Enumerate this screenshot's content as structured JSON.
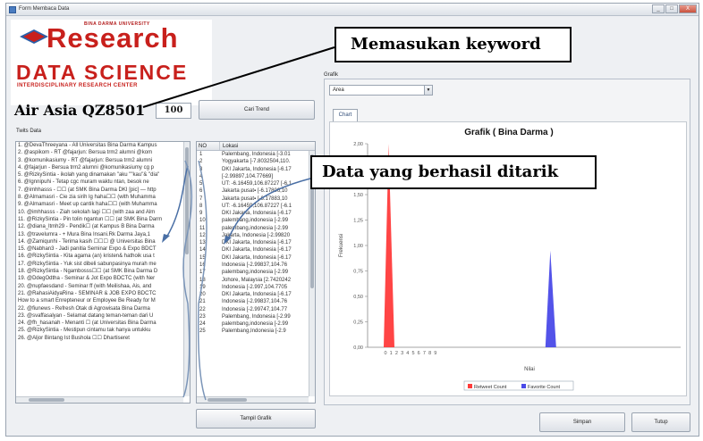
{
  "window": {
    "title": "Form Membaca Data",
    "controls": [
      "_",
      "□",
      "X"
    ]
  },
  "logo": {
    "university": "BINA DARMA UNIVERSITY",
    "research": "Research",
    "data_science": "DATA SCIENCE",
    "subtitle": "INTERDISCIPLINARY RESEARCH CENTER",
    "colors": {
      "primary": "#c8201c",
      "secondary": "#2c5fa8"
    }
  },
  "search": {
    "keyword": "Air Asia QZ8501",
    "count": "100",
    "button_label": "Cari Trend"
  },
  "twits": {
    "label": "Twits Data",
    "lines": [
      "1. @DevaThreeyana - All Universitas Bina Darma Kampus",
      "2. @aspikom - RT @fajarjun: Bersua trm2 alumni @kom",
      "3. @komunikasiumy - RT @fajarjun: Bersua trm2 alumni",
      "4. @fajarjun - Bersua trm2 alumni @komunikasiumy cg p",
      "5. @RizkySintia - ikolah yang dinamakan \"aku \"\"kau\"& \"dia\"",
      "6. @Ignnipuhi - Tetap cgc muram waktu ntan, besok ne",
      "7. @imhhasss - ☐☐ (at SMK Bina Darma DKI [pic] — http",
      "8. @Almamasri - Cie zia sirih lg haha☐☐ (with Muhamma",
      "9. @Almamasri - Meet up cantik haha☐☐ (with Muhamma",
      "10. @imhhasss - Ziah sekolah lagi ☐☐ (with zaa and Alm",
      "11. @RizkySintia - Pin tolin ngantun ☐☐ (at SMK Bina Darm",
      "12. @diana_ltmh29 - Pendik☐ (at Kampus B Bina Darma",
      "13. @travelumra - + Mura Bina Insani.Rk Darma Jaya,1",
      "14. @Zamiqunhi - Terima kasih ☐☐☐ @ Universitas Bina",
      "15. @Nabhan3 - Jadi panitia Seminar Expo & Expo BDCT",
      "16. @RizkySintia - Kita agama (an) kristen& hathoik usa t",
      "17. @RizkySintia - Yuk sist dibeli sabunpasinya murah me",
      "18. @RizkySintia - Ngambosss☐☐ (at SMK Bina Darma D",
      "19. @DdegOdtha - Seminar & Jot Expo BDCTC (with Ner",
      "20. @nupfaesdand - Seminar ff (with Meilishaa, Ais, and",
      "21. @RahasiAidyaRina - SEMINAR & JOB EXPO BDCTC",
      "",
      "How to a smart Enrepteneur or Employee Be Ready for M",
      "22. @fiunews - Refresh Otak di Agrowisata Bina Darma",
      "23. @svaffasalyan - Selamat datang teman-teman dari U",
      "24. @fh_hasanah - Menanti ☐ (at Universitas Bina Darma",
      "25. @RizkySintia - Mestipun cintamu tak hanya untukku",
      "26. @Aljor Bintang Ist Bushola ☐☐ Dhartiseret"
    ]
  },
  "table": {
    "headers": [
      "NO",
      "Lokasi"
    ],
    "rows": [
      [
        "1",
        "Palembang, Indonesia [-3.01"
      ],
      [
        "2",
        "Yogyakarta [-7.8032504,110."
      ],
      [
        "3",
        "DKI Jakarta, Indonesia [-6.17"
      ],
      [
        "4",
        "[-2.99897,104.77669]"
      ],
      [
        "5",
        "ÜT: -6.16459,106.87227 [-6.1"
      ],
      [
        "6",
        "Jakarta pusat▪ [-6.17806,10"
      ],
      [
        "7",
        "Jakarta pusat▪ [-6.17883,10"
      ],
      [
        "8",
        "ÜT: -6.16459,106.87227 [-6.1"
      ],
      [
        "9",
        "DKI Jakarta, Indonesia [-6.17"
      ],
      [
        "10",
        "palembang,indonesia [-2.99"
      ],
      [
        "11",
        "palembang,indonesia [-2.99"
      ],
      [
        "12",
        "Jakarta, Indonesia [-2.99820"
      ],
      [
        "13",
        "DKI Jakarta, Indonesia [-6.17"
      ],
      [
        "14",
        "DKI Jakarta, Indonesia [-6.17"
      ],
      [
        "15",
        "DKI Jakarta, Indonesia [-6.17"
      ],
      [
        "16",
        "Indonesia [-2.99837,104.76"
      ],
      [
        "17",
        "palembang,indonesia [-2.99"
      ],
      [
        "18",
        "Johore, Malaysia [2.7420242"
      ],
      [
        "19",
        "Indonesia [-2.997,104.7705"
      ],
      [
        "20",
        "DKI Jakarta, Indonesia [-6.17"
      ],
      [
        "21",
        "Indonesia [-2.99837,104.76"
      ],
      [
        "22",
        "Indonesia [-2.99747,104.77"
      ],
      [
        "23",
        "Palembang, Indonesia [-2.99"
      ],
      [
        "24",
        "palembang,indonesia [-2.99"
      ],
      [
        "25",
        "Palembang,Indonesia [-2.9"
      ]
    ]
  },
  "buttons": {
    "tampil": "Tampil Grafik",
    "simpan": "Simpan",
    "tutup": "Tutup"
  },
  "grafik": {
    "label": "Grafik",
    "select_value": "Area",
    "tab_label": "Chart"
  },
  "chart_data": {
    "type": "area",
    "title": "Grafik ( Bina Darma )",
    "xlabel": "Nilai",
    "ylabel": "Frekuensi",
    "x_ticks": [
      "0",
      "1",
      "2",
      "3",
      "4",
      "5",
      "6",
      "7",
      "8",
      "9"
    ],
    "y_ticks": [
      "0,00",
      "0,25",
      "0,50",
      "0,75",
      "1,00",
      "1,25",
      "1,50",
      "1,75",
      "2,00"
    ],
    "ylim": [
      0,
      2
    ],
    "series": [
      {
        "name": "Retweet Count",
        "color": "#ff3b3b",
        "peak_x": 0,
        "peak_y": 2.0
      },
      {
        "name": "Favorite Count",
        "color": "#4a4ae8",
        "peak_x": 16,
        "peak_y": 0.95
      }
    ],
    "legend": "bottom"
  },
  "callouts": {
    "keyword": "Memasukan keyword",
    "data": "Data yang berhasil ditarik"
  }
}
